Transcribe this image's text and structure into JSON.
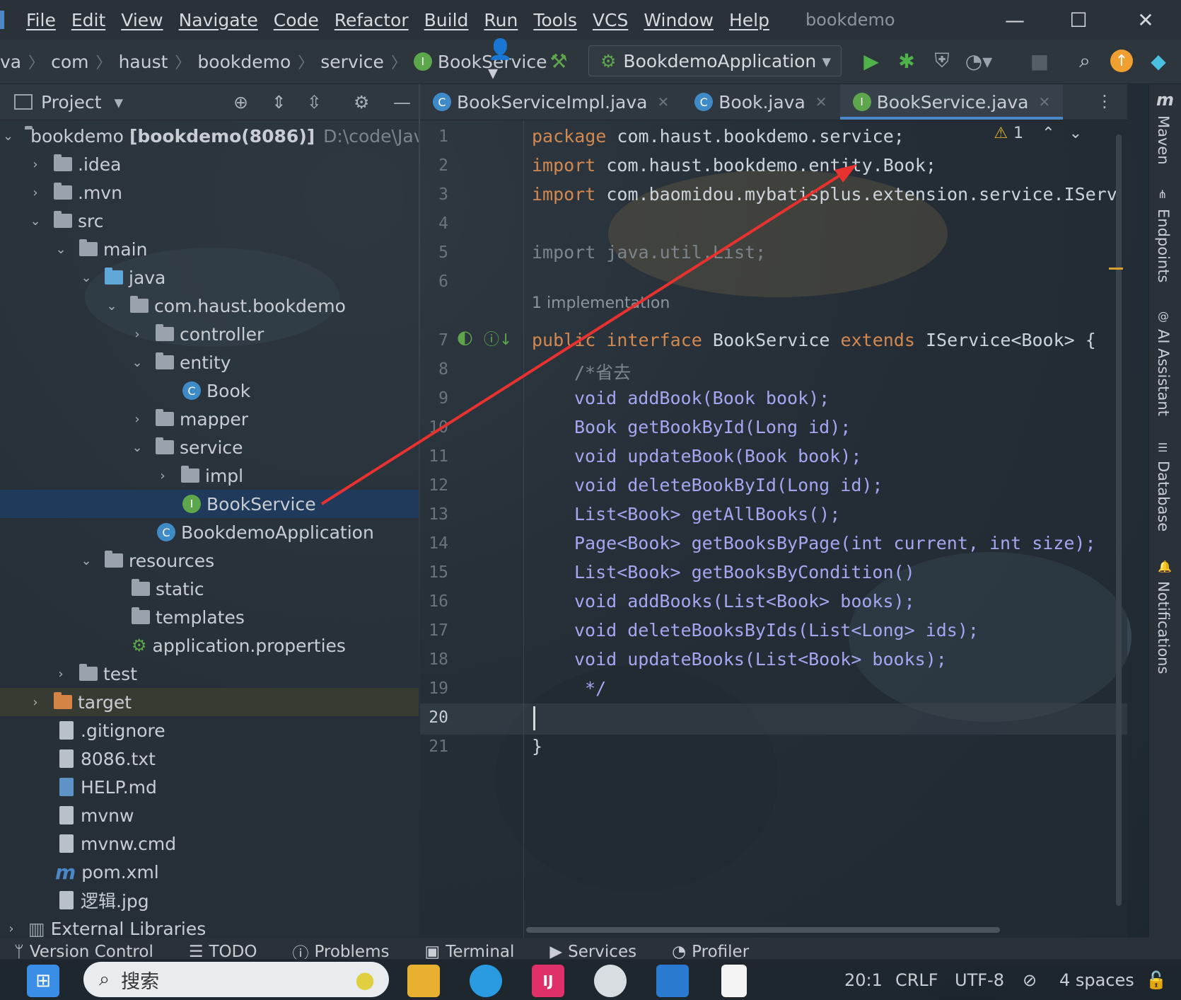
{
  "menubar": {
    "items": [
      "File",
      "Edit",
      "View",
      "Navigate",
      "Code",
      "Refactor",
      "Build",
      "Run",
      "Tools",
      "VCS",
      "Window",
      "Help"
    ],
    "project_title": "bookdemo"
  },
  "navbar": {
    "breadcrumbs": [
      "va",
      "com",
      "haust",
      "bookdemo",
      "service",
      "BookService"
    ],
    "run_config": "BookdemoApplication"
  },
  "project_panel": {
    "title": "Project",
    "rows": [
      {
        "label": "bookdemo",
        "suffix": "[bookdemo(8086)]",
        "path": "D:\\code\\Java"
      },
      {
        "label": ".idea"
      },
      {
        "label": ".mvn"
      },
      {
        "label": "src"
      },
      {
        "label": "main"
      },
      {
        "label": "java"
      },
      {
        "label": "com.haust.bookdemo"
      },
      {
        "label": "controller"
      },
      {
        "label": "entity"
      },
      {
        "label": "Book"
      },
      {
        "label": "mapper"
      },
      {
        "label": "service"
      },
      {
        "label": "impl"
      },
      {
        "label": "BookService"
      },
      {
        "label": "BookdemoApplication"
      },
      {
        "label": "resources"
      },
      {
        "label": "static"
      },
      {
        "label": "templates"
      },
      {
        "label": "application.properties"
      },
      {
        "label": "test"
      },
      {
        "label": "target"
      },
      {
        "label": ".gitignore"
      },
      {
        "label": "8086.txt"
      },
      {
        "label": "HELP.md"
      },
      {
        "label": "mvnw"
      },
      {
        "label": "mvnw.cmd"
      },
      {
        "label": "pom.xml"
      },
      {
        "label": "逻辑.jpg"
      },
      {
        "label": "External Libraries"
      }
    ]
  },
  "tabs": [
    {
      "label": "BookServiceImpl.java",
      "icon": "C"
    },
    {
      "label": "Book.java",
      "icon": "C"
    },
    {
      "label": "BookService.java",
      "icon": "I",
      "active": true
    }
  ],
  "editor": {
    "warning_count": "1",
    "implementation_hint": "1 implementation",
    "line_numbers": [
      "1",
      "2",
      "3",
      "4",
      "5",
      "6",
      "7",
      "8",
      "9",
      "10",
      "11",
      "12",
      "13",
      "14",
      "15",
      "16",
      "17",
      "18",
      "19",
      "20",
      "21"
    ],
    "lines": {
      "l1": {
        "kw": "package",
        "rest": " com.haust.bookdemo.service;"
      },
      "l2": {
        "kw": "import",
        "rest": " com.haust.bookdemo.entity.Book;"
      },
      "l3": {
        "kw": "import",
        "rest": " com.baomidou.mybatisplus.extension.service.IServ"
      },
      "l5": "import java.util.List;",
      "l7": {
        "kw1": "public",
        "kw2": "interface",
        "name": "BookService",
        "kw3": "extends",
        "rest": "IService<Book> {"
      },
      "l8": "/*省去",
      "l9": "void addBook(Book book);",
      "l10": "Book getBookById(Long id);",
      "l11": "void updateBook(Book book);",
      "l12": "void deleteBookById(Long id);",
      "l13": "List<Book> getAllBooks();",
      "l14": "Page<Book> getBooksByPage(int current, int size);",
      "l15": "List<Book> getBooksByCondition()",
      "l16": "void addBooks(List<Book> books);",
      "l17": "void deleteBooksByIds(List<Long> ids);",
      "l18": "void updateBooks(List<Book> books);",
      "l19": " */",
      "l21": "}"
    }
  },
  "right_strip": [
    "Maven",
    "Endpoints",
    "AI Assistant",
    "Database",
    "Notifications"
  ],
  "bottom_tools": [
    "Version Control",
    "TODO",
    "Problems",
    "Terminal",
    "Services",
    "Profiler"
  ],
  "taskbar": {
    "search_label": "搜索"
  },
  "status": {
    "position": "20:1",
    "line_sep": "CRLF",
    "encoding": "UTF-8",
    "indent": "4 spaces"
  },
  "colors": {
    "accent": "#4a88c7",
    "keyword": "#d3884f",
    "method": "#a3a7f0",
    "annotation_arrow": "#e8322f"
  }
}
